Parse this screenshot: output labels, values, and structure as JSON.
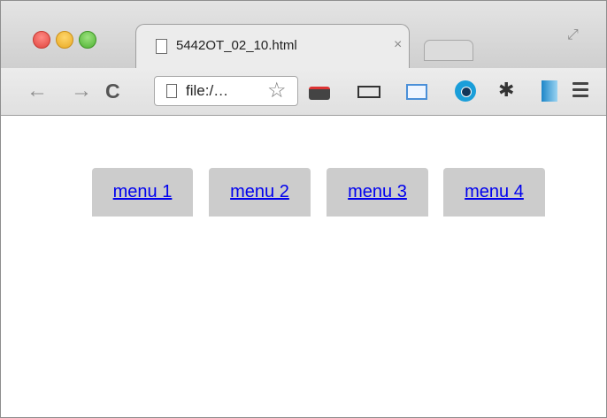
{
  "browser": {
    "tab_title": "5442OT_02_10.html",
    "tab_close": "×",
    "address": "file:/…",
    "back_glyph": "←",
    "forward_glyph": "→",
    "reload_glyph": "C",
    "star_glyph": "☆",
    "gear_glyph": "✱",
    "fullscreen_glyph": "⤢"
  },
  "menu": {
    "items": [
      {
        "label": "menu 1"
      },
      {
        "label": "menu 2"
      },
      {
        "label": "menu 3"
      },
      {
        "label": "menu 4"
      }
    ]
  },
  "colors": {
    "menu_background": "#cccccc",
    "link": "#0000ee"
  }
}
